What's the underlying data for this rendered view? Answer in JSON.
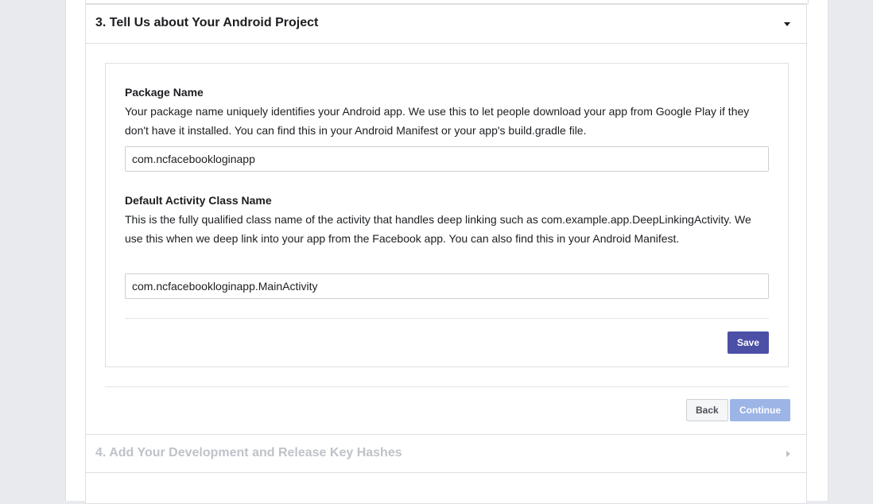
{
  "section3": {
    "title": "3. Tell Us about Your Android Project"
  },
  "package": {
    "label": "Package Name",
    "description": "Your package name uniquely identifies your Android app. We use this to let people download your app from Google Play if they don't have it installed. You can find this in your Android Manifest or your app's build.gradle file.",
    "value": "com.ncfacebookloginapp"
  },
  "activity": {
    "label": "Default Activity Class Name",
    "description": "This is the fully qualified class name of the activity that handles deep linking such as com.example.app.DeepLinkingActivity. We use this when we deep link into your app from the Facebook app. You can also find this in your Android Manifest.",
    "value": "com.ncfacebookloginapp.MainActivity"
  },
  "buttons": {
    "save": "Save",
    "back": "Back",
    "continue": "Continue"
  },
  "section4": {
    "title": "4. Add Your Development and Release Key Hashes"
  },
  "icons": {
    "section3_toggle": "caret-down-icon",
    "section4_toggle": "caret-right-icon"
  },
  "colors": {
    "save_button": "#4b4fa6",
    "continue_button_disabled": "#9cb4e6",
    "disabled_title": "#bec3c9"
  }
}
